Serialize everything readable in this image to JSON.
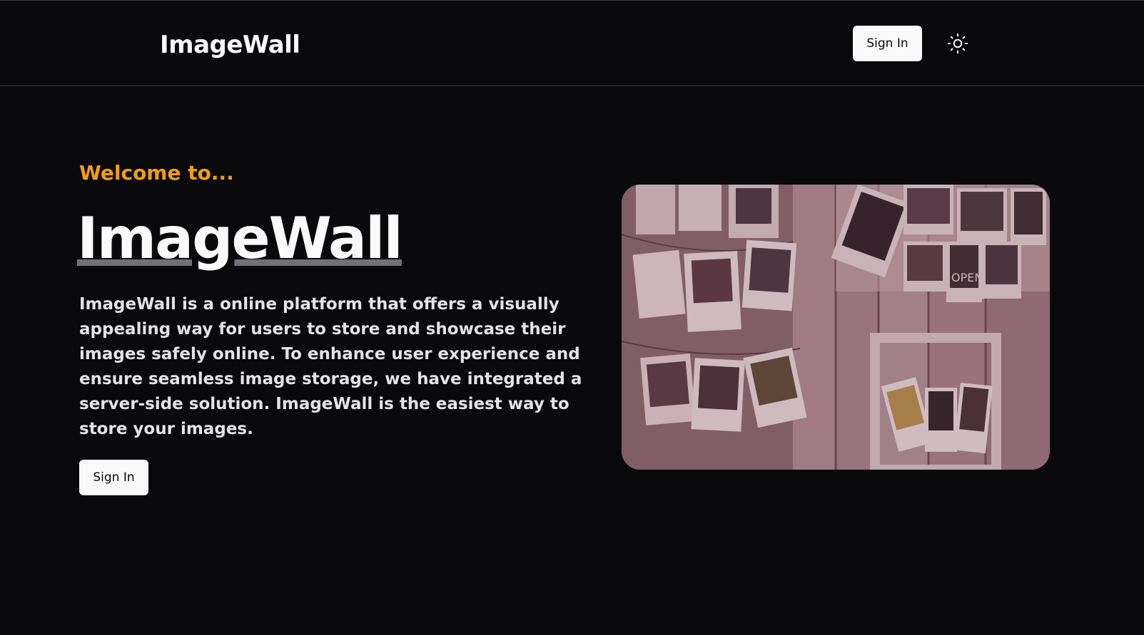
{
  "header": {
    "brand": "ImageWall",
    "signin_label": "Sign In",
    "theme_toggle_icon": "sun-icon"
  },
  "hero": {
    "welcome": "Welcome to...",
    "title": "ImageWall",
    "description": "ImageWall is a online platform that offers a visually appealing way for users to store and showcase their images safely online. To enhance user experience and ensure seamless image storage, we have integrated a server-side solution. ImageWall is the easiest way to store your images.",
    "signin_label": "Sign In",
    "image": {
      "icon": "photo-wall-image",
      "open_sign": "OPEN"
    }
  },
  "colors": {
    "background": "#09090b",
    "accent": "#f59e0b",
    "text": "#fafafa",
    "underline": "#71717a"
  }
}
